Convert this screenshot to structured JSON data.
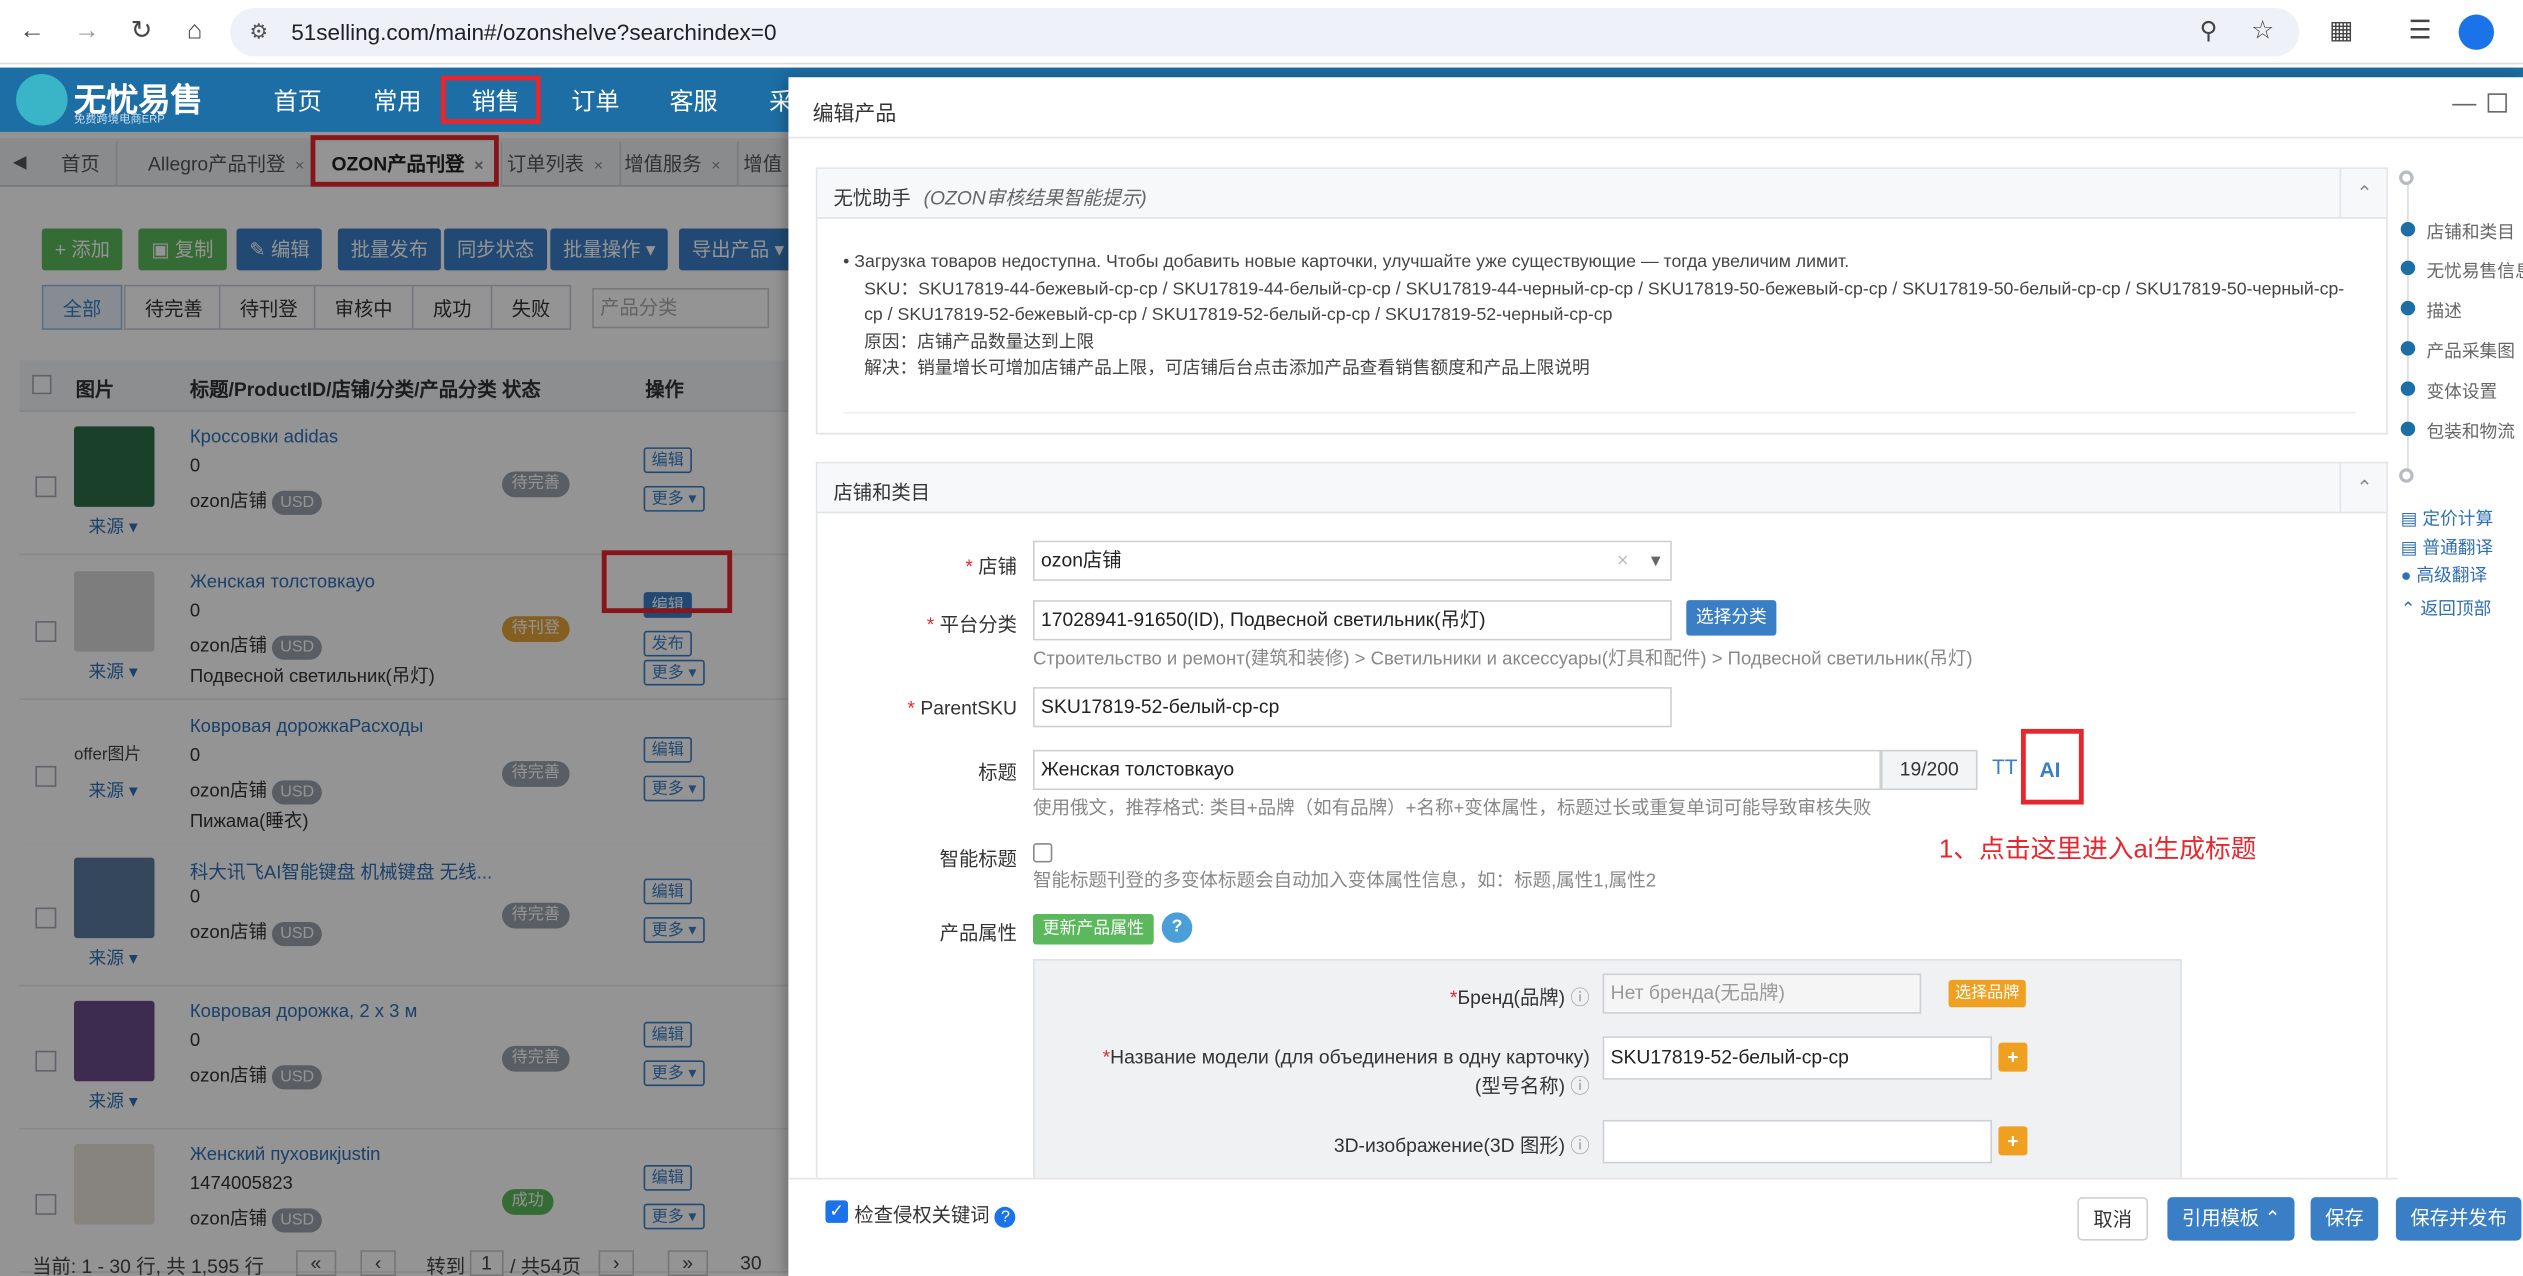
{
  "browser": {
    "url": "51selling.com/main#/ozonshelve?searchindex=0"
  },
  "app": {
    "logo": "无忧易售",
    "logo_sub": "免费跨境电商ERP",
    "menu": [
      "首页",
      "常用",
      "销售",
      "订单",
      "客服",
      "采"
    ]
  },
  "tabs": [
    "首页",
    "Allegro产品刊登",
    "OZON产品刊登",
    "订单列表",
    "增值服务",
    "增值"
  ],
  "toolbar": {
    "add": "添加",
    "copy": "复制",
    "edit": "编辑",
    "batch_publish": "批量发布",
    "sync": "同步状态",
    "batch_ops": "批量操作",
    "export": "导出产品"
  },
  "filters": {
    "items": [
      "全部",
      "待完善",
      "待刊登",
      "审核中",
      "成功",
      "失败"
    ],
    "category_placeholder": "产品分类"
  },
  "grid": {
    "headers": [
      "图片",
      "标题/ProductID/店铺/分类/产品分类",
      "状态",
      "操作"
    ],
    "rows": [
      {
        "title": "Кроссовки adidas",
        "id": "0",
        "shop": "ozon店铺",
        "cur": "USD",
        "cat": "",
        "status": "待完善",
        "sc": "#9aa3ad",
        "ops": [
          "编辑",
          "更多"
        ],
        "src": "来源",
        "img": "#2e6e4a"
      },
      {
        "title": "Женская толстовкауо",
        "id": "0",
        "shop": "ozon店铺",
        "cur": "USD",
        "cat": "Подвесной светильник(吊灯)",
        "status": "待刊登",
        "sc": "#e6a23c",
        "ops": [
          "编辑",
          "发布",
          "更多"
        ],
        "src": "来源",
        "img": "#d8d8d8"
      },
      {
        "title": "Ковровая дорожкаРасходы",
        "id": "0",
        "shop": "ozon店铺",
        "cur": "USD",
        "cat": "Пижама(睡衣)",
        "status": "待完善",
        "sc": "#9aa3ad",
        "ops": [
          "编辑",
          "更多"
        ],
        "src": "来源",
        "img": "",
        "alt": "offer图片"
      },
      {
        "title": "科大讯飞AI智能键盘 机械键盘 无线...",
        "id": "0",
        "shop": "ozon店铺",
        "cur": "USD",
        "cat": "",
        "status": "待完善",
        "sc": "#9aa3ad",
        "ops": [
          "编辑",
          "更多"
        ],
        "src": "来源",
        "img": "#5a7aa0"
      },
      {
        "title": "Ковровая дорожка, 2 х 3 м",
        "id": "0",
        "shop": "ozon店铺",
        "cur": "USD",
        "cat": "",
        "status": "待完善",
        "sc": "#9aa3ad",
        "ops": [
          "编辑",
          "更多"
        ],
        "src": "来源",
        "img": "#6a4a8a"
      },
      {
        "title": "Женский пуховикjustin",
        "id": "1474005823",
        "shop": "ozon店铺",
        "cur": "USD",
        "cat": "",
        "status": "成功",
        "sc": "#5cb85c",
        "ops": [
          "编辑",
          "更多"
        ],
        "src": "",
        "img": "#e8e4dc"
      }
    ]
  },
  "pager": {
    "info": "当前: 1 - 30 行, 共 1,595 行",
    "goto": "转到",
    "page": "1",
    "total": "/ 共54页",
    "size": "30"
  },
  "dialog": {
    "title": "编辑产品",
    "assistant": {
      "title": "无忧助手",
      "subtitle": "(OZON审核结果智能提示)",
      "msg": "Загрузка товаров недоступна. Чтобы добавить новые карточки, улучшайте уже существующие — тогда увеличим лимит.",
      "sku": "SKU：SKU17819-44-бежевый-cp-cp / SKU17819-44-белый-cp-cp / SKU17819-44-черный-cp-cp / SKU17819-50-бежевый-cp-cp / SKU17819-50-белый-cp-cp / SKU17819-50-черный-cp-cp / SKU17819-52-бежевый-cp-cp / SKU17819-52-белый-cp-cp / SKU17819-52-черный-cp-cp",
      "reason": "原因：店铺产品数量达到上限",
      "solution": "解决：销量增长可增加店铺产品上限，可店铺后台点击添加产品查看销售额度和产品上限说明"
    },
    "shop_section": "店铺和类目",
    "shop_label": "店铺",
    "shop_value": "ozon店铺",
    "platform_label": "平台分类",
    "platform_value": "17028941-91650(ID), Подвесной светильник(吊灯)",
    "select_category": "选择分类",
    "category_path": "Строительство и ремонт(建筑和装修) > Светильники и аксессуары(灯具和配件) > Подвесной светильник(吊灯)",
    "parent_label": "ParentSKU",
    "parent_value": "SKU17819-52-белый-cp-cp",
    "title_label": "标题",
    "title_value": "Женская толстовкауо",
    "title_count": "19/200",
    "title_tt": "TT",
    "title_ai": "AI",
    "title_hint": "使用俄文，推荐格式: 类目+品牌（如有品牌）+名称+变体属性，标题过长或重复单词可能导致审核失败",
    "annotation": "1、点击这里进入ai生成标题",
    "smart_label": "智能标题",
    "smart_hint": "智能标题刊登的多变体标题会自动加入变体属性信息，如：标题,属性1,属性2",
    "attr_label": "产品属性",
    "update_attr": "更新产品属性",
    "brand_label": "Бренд(品牌)",
    "brand_placeholder": "Нет бренда(无品牌)",
    "select_brand": "选择品牌",
    "model_label1": "Название модели (для объединения в одну карточку)",
    "model_label2": "(型号名称)",
    "model_value": "SKU17819-52-белый-cp-cp",
    "img3d_label": "3D-изображение(3D 图形)",
    "check_label": "检查侵权关键词",
    "btn_cancel": "取消",
    "btn_template": "引用模板",
    "btn_save": "保存",
    "btn_save_publish": "保存并发布"
  },
  "rightnav": {
    "items": [
      "店铺和类目",
      "无忧易售信息",
      "描述",
      "产品采集图",
      "变体设置",
      "包装和物流"
    ],
    "links": [
      "定价计算",
      "普通翻译",
      "高级翻译",
      "返回顶部"
    ]
  },
  "colors": {
    "header": "#1c6ea4",
    "primary": "#3a7fc6",
    "success": "#5cb85c",
    "warning": "#e6a23c",
    "annotation": "#e8262d"
  }
}
